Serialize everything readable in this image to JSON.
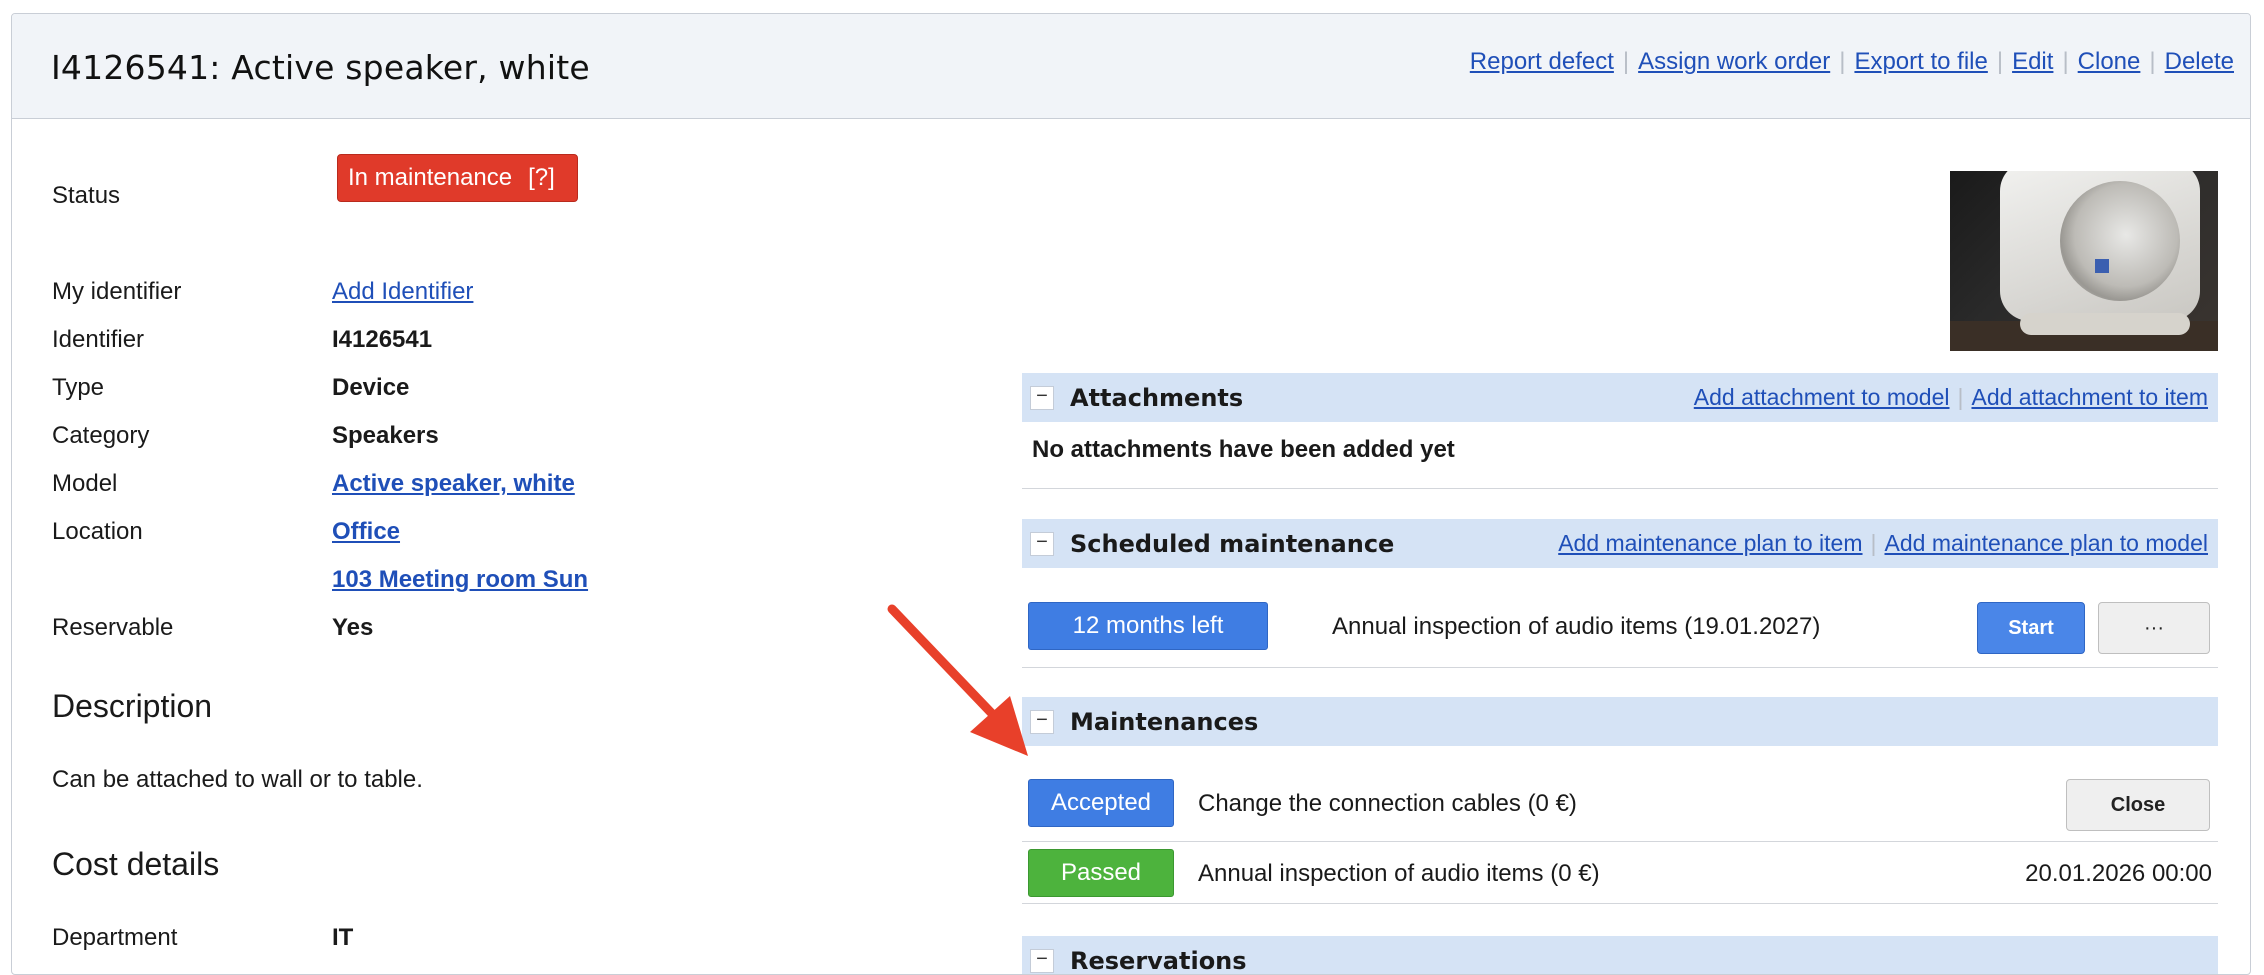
{
  "header": {
    "title": "I4126541: Active speaker, white",
    "actions": [
      "Report defect",
      "Assign work order",
      "Export to file",
      "Edit",
      "Clone",
      "Delete"
    ]
  },
  "details": {
    "status_label": "Status",
    "status_value": "In maintenance",
    "status_help": "[?]",
    "fields": [
      {
        "label": "My identifier",
        "value": "Add Identifier"
      },
      {
        "label": "Identifier",
        "value": "I4126541"
      },
      {
        "label": "Type",
        "value": "Device"
      },
      {
        "label": "Category",
        "value": "Speakers"
      },
      {
        "label": "Model",
        "value": "Active speaker, white"
      },
      {
        "label": "Location",
        "value": "Office"
      },
      {
        "label": "",
        "value": "103 Meeting room Sun"
      },
      {
        "label": "Reservable",
        "value": "Yes"
      }
    ],
    "description_heading": "Description",
    "description_text": "Can be attached to wall or to table.",
    "cost_heading": "Cost details",
    "cost_fields": [
      {
        "label": "Department",
        "value": "IT"
      }
    ]
  },
  "attachments": {
    "title": "Attachments",
    "links": [
      "Add attachment to model",
      "Add attachment to item"
    ],
    "empty_text": "No attachments have been added yet"
  },
  "scheduled": {
    "title": "Scheduled maintenance",
    "links": [
      "Add maintenance plan to item",
      "Add maintenance plan to model"
    ],
    "item": {
      "badge": "12 months left",
      "text": "Annual inspection of audio items (19.01.2027)",
      "start_label": "Start",
      "more_label": "···"
    }
  },
  "maintenances": {
    "title": "Maintenances",
    "items": [
      {
        "badge": "Accepted",
        "text": "Change the connection cables (0 €)",
        "action": "Close"
      },
      {
        "badge": "Passed",
        "text": "Annual inspection of audio items (0 €)",
        "date": "20.01.2026 00:00"
      }
    ]
  },
  "reservations": {
    "title": "Reservations"
  },
  "icons": {
    "toggle": "minus-icon",
    "annotation": "red-arrow-icon"
  },
  "colors": {
    "status": "#e03a2a",
    "accepted": "#3f7de3",
    "passed": "#4db33d",
    "section": "#d5e3f5"
  }
}
